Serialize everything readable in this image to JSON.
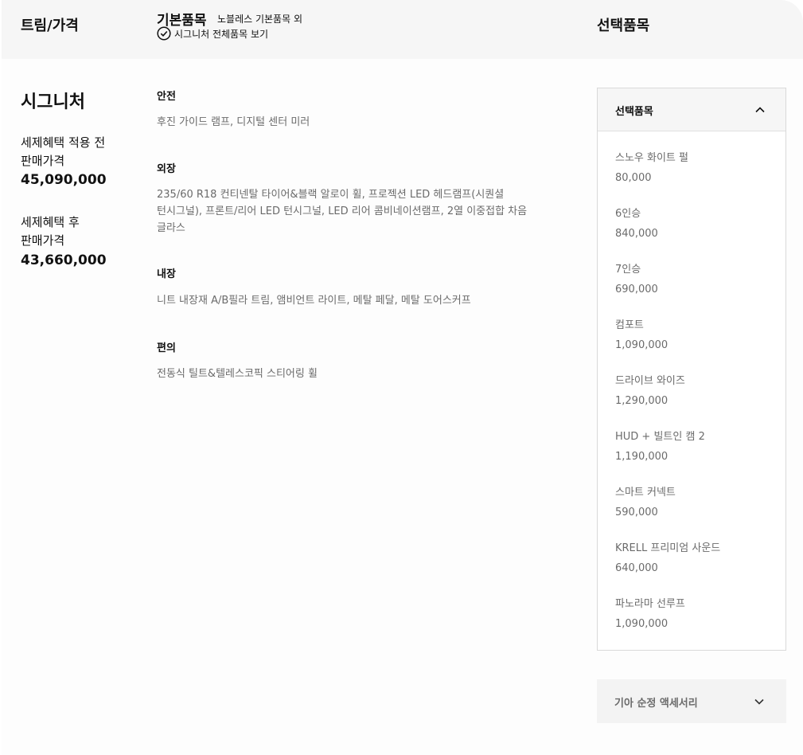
{
  "header": {
    "trim_price_title": "트림/가격",
    "basic_title": "기본품목",
    "basic_subtitle": "노블레스 기본품목 외",
    "full_list_link": "시그니처 전체품목 보기",
    "options_title": "선택품목"
  },
  "trim": {
    "name": "시그니처",
    "before_tax_label_line1": "세제혜택 적용 전",
    "before_tax_label_line2": "판매가격",
    "before_tax_price": "45,090,000",
    "after_tax_label_line1": "세제혜택 후",
    "after_tax_label_line2": "판매가격",
    "after_tax_price": "43,660,000"
  },
  "categories": [
    {
      "title": "안전",
      "lines": [
        "후진 가이드 램프, 디지털 센터 미러"
      ]
    },
    {
      "title": "외장",
      "lines": [
        "235/60 R18 컨티넨탈 타이어&블랙 알로이 휠, 프로젝션 LED 헤드램프(시퀀셜",
        "턴시그널), 프론트/리어 LED 턴시그널, LED 리어 콤비네이션램프, 2열 이중접합 차음",
        "글라스"
      ]
    },
    {
      "title": "내장",
      "lines": [
        "니트 내장재 A/B필라 트림, 앰비언트 라이트, 메탈 페달, 메탈 도어스커프"
      ]
    },
    {
      "title": "편의",
      "lines": [
        "전동식 틸트&텔레스코픽 스티어링 휠"
      ]
    }
  ],
  "options_panel": {
    "title": "선택품목",
    "items": [
      {
        "name": "스노우 화이트 펄",
        "price": "80,000"
      },
      {
        "name": "6인승",
        "price": "840,000"
      },
      {
        "name": "7인승",
        "price": "690,000"
      },
      {
        "name": "컴포트",
        "price": "1,090,000"
      },
      {
        "name": "드라이브 와이즈",
        "price": "1,290,000"
      },
      {
        "name": "HUD + 빌트인 캠 2",
        "price": "1,190,000"
      },
      {
        "name": "스마트 커넥트",
        "price": "590,000"
      },
      {
        "name": "KRELL 프리미엄 사운드",
        "price": "640,000"
      },
      {
        "name": "파노라마 선루프",
        "price": "1,090,000"
      }
    ]
  },
  "accessories": {
    "title": "기아 순정 액세서리"
  },
  "icons": {
    "check": "check-circle-icon",
    "collapse": "chevron-up-icon",
    "expand": "chevron-down-icon"
  }
}
